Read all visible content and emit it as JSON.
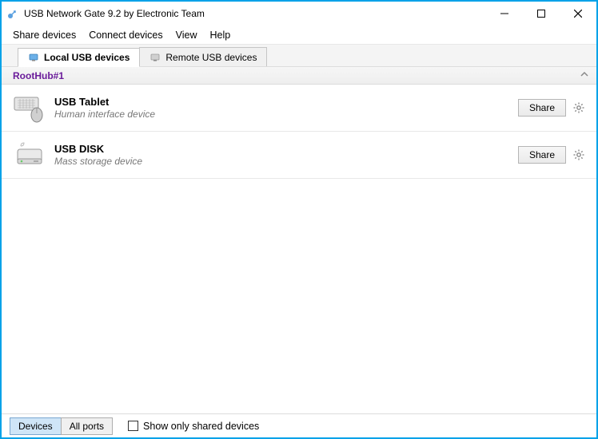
{
  "window": {
    "title": "USB Network Gate 9.2 by Electronic Team"
  },
  "menu": {
    "share": "Share devices",
    "connect": "Connect devices",
    "view": "View",
    "help": "Help"
  },
  "tabs": {
    "local": "Local USB devices",
    "remote": "Remote USB devices"
  },
  "hub": {
    "name": "RootHub#1"
  },
  "devices": [
    {
      "name": "USB Tablet",
      "type": "Human interface device",
      "share_label": "Share",
      "icon": "keyboard-mouse"
    },
    {
      "name": "USB DISK",
      "type": "Mass storage device",
      "share_label": "Share",
      "icon": "disk"
    }
  ],
  "bottom": {
    "devices_btn": "Devices",
    "allports_btn": "All ports",
    "show_only_shared": "Show only shared devices"
  }
}
